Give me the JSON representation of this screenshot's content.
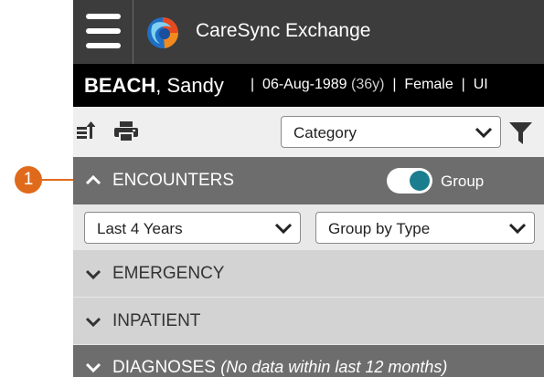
{
  "callout": {
    "number": "1",
    "color": "#e06a1b"
  },
  "app": {
    "title": "CareSync Exchange",
    "header_color": "#3c3c3c",
    "accent": "#1a7e8e"
  },
  "patient": {
    "last_name": "BEACH",
    "first_name": ", Sandy",
    "sep1": "|",
    "dob": "06-Aug-1989",
    "age": "(36y)",
    "sep2": "|",
    "sex": "Female",
    "sep3": "|",
    "truncated": "UI"
  },
  "toolbar": {
    "export_icon": "export-list-icon",
    "print_icon": "printer-icon",
    "category_select": "Category",
    "filter_icon": "funnel-icon"
  },
  "encounters": {
    "label": "ENCOUNTERS",
    "group_toggle_label": "Group",
    "group_toggle_on": true,
    "date_range": "Last 4 Years",
    "grouping": "Group by Type",
    "groups": [
      {
        "label": "EMERGENCY"
      },
      {
        "label": "INPATIENT"
      }
    ]
  },
  "diagnoses": {
    "label": "DIAGNOSES",
    "note": "(No data within last 12 months)"
  }
}
